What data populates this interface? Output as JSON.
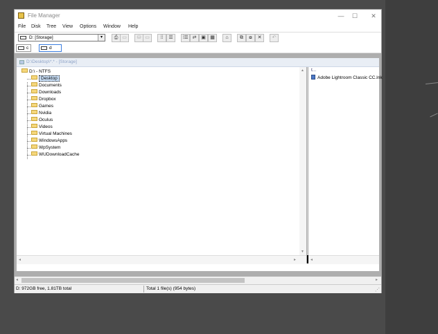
{
  "window": {
    "title": "File Manager",
    "controls": {
      "minimize": "—",
      "maximize": "☐",
      "close": "✕"
    }
  },
  "menu": [
    "File",
    "Disk",
    "Tree",
    "View",
    "Options",
    "Window",
    "Help"
  ],
  "toolbar": {
    "drive_select": "D: [Storage]",
    "buttons": [
      "⎙",
      "▭",
      "⛁",
      "▭",
      "⁞⁞",
      "☰",
      "⁞☰",
      "⇄",
      "▣",
      "▦",
      "⌂",
      "⧉",
      "⧇",
      "✕",
      "↶"
    ]
  },
  "drives": [
    "c",
    "d"
  ],
  "child_window": {
    "title": "D:\\Desktop\\*.* - [Storage]",
    "tree": {
      "root": "D:\\ - NTFS",
      "items": [
        "Desktop",
        "Documents",
        "Downloads",
        "Dropbox",
        "Games",
        "Nvidia",
        "Oculus",
        "Videos",
        "Virtual Machines",
        "WindowsApps",
        "WpSystem",
        "WUDownloadCache"
      ],
      "selected": "Desktop"
    },
    "files": {
      "up": "t...",
      "items": [
        "Adobe Lightroom Classic CC.lnk"
      ]
    }
  },
  "status": {
    "left": "D: 972GB free,  1.81TB total",
    "right": "Total 1 file(s) (954 bytes)"
  }
}
